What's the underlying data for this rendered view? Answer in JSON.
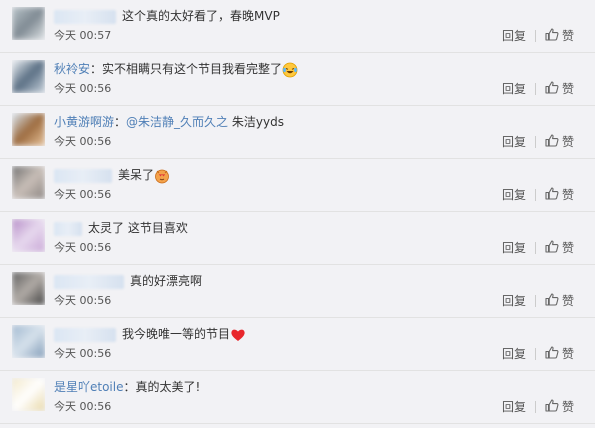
{
  "comments": [
    {
      "masked_width": 62,
      "text": "这个真的太好看了，春晚MVP",
      "time": "今天 00:57",
      "reply": "回复",
      "like": "赞",
      "avatar_colors": [
        "#b9c4c9",
        "#7f8a93",
        "#dfe4e6"
      ]
    },
    {
      "username": "秋袊安",
      "text": "实不相瞒只有这个节目我看完整了",
      "emoji": "laugh-cry-emoji",
      "time": "今天 00:56",
      "reply": "回复",
      "like": "赞",
      "avatar_colors": [
        "#eef2f5",
        "#5a6f84",
        "#c7d2dc"
      ]
    },
    {
      "username": "小黄游啊游",
      "mention": "@朱洁静_久而久之",
      "text": "朱洁yyds",
      "time": "今天 00:56",
      "reply": "回复",
      "like": "赞",
      "avatar_colors": [
        "#d9e6f1",
        "#9c6b3f",
        "#e8c39a"
      ]
    },
    {
      "masked_width": 58,
      "text": "美呆了",
      "emoji": "heart-eyes-emoji",
      "time": "今天 00:56",
      "reply": "回复",
      "like": "赞",
      "avatar_colors": [
        "#6d6d6d",
        "#c9bfb8",
        "#8a8380"
      ]
    },
    {
      "masked_width": 28,
      "text": "太灵了 这节目喜欢",
      "time": "今天 00:56",
      "reply": "回复",
      "like": "赞",
      "avatar_colors": [
        "#b48ac6",
        "#e7d9ee",
        "#c8a6d6"
      ]
    },
    {
      "masked_width": 70,
      "text": "真的好漂亮啊",
      "time": "今天 00:56",
      "reply": "回复",
      "like": "赞",
      "avatar_colors": [
        "#5c5c5c",
        "#b2aca7",
        "#3e3e3e"
      ]
    },
    {
      "masked_width": 62,
      "text": "我今晚唯一等的节目",
      "emoji": "red-heart-emoji",
      "time": "今天 00:56",
      "reply": "回复",
      "like": "赞",
      "avatar_colors": [
        "#9fb7cf",
        "#d7e2ec",
        "#7d98b5"
      ]
    },
    {
      "username": "是星吖etoile",
      "text": "真的太美了!",
      "time": "今天 00:56",
      "reply": "回复",
      "like": "赞",
      "avatar_colors": [
        "#f2e8c9",
        "#ffffff",
        "#e7d6a3"
      ]
    }
  ]
}
